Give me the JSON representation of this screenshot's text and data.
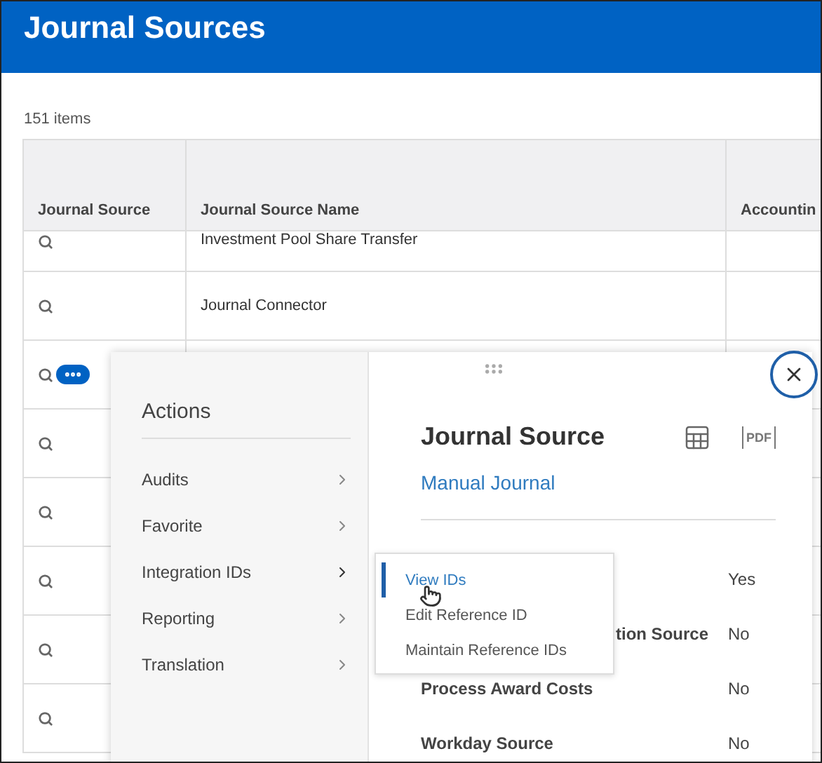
{
  "page": {
    "title": "Journal Sources",
    "count": "151 items"
  },
  "table": {
    "columns": [
      "Journal Source",
      "Journal Source Name",
      "Accountin"
    ],
    "rows": [
      {
        "name": "Investment Pool Share Transfer",
        "partial": true,
        "actions_open": false
      },
      {
        "name": "Journal Connector",
        "partial": false,
        "actions_open": false
      },
      {
        "partial": false,
        "actions_open": true
      },
      {
        "partial": false,
        "actions_open": false
      },
      {
        "partial": false,
        "actions_open": false
      },
      {
        "partial": false,
        "actions_open": false
      },
      {
        "partial": false,
        "actions_open": false
      },
      {
        "partial": false,
        "actions_open": false
      }
    ]
  },
  "actions_menu": {
    "title": "Actions",
    "items": [
      {
        "label": "Audits",
        "expanded": false
      },
      {
        "label": "Favorite",
        "expanded": false
      },
      {
        "label": "Integration IDs",
        "expanded": true
      },
      {
        "label": "Reporting",
        "expanded": false
      },
      {
        "label": "Translation",
        "expanded": false
      }
    ],
    "submenu": [
      {
        "label": "View IDs",
        "selected": true
      },
      {
        "label": "Edit Reference ID",
        "selected": false
      },
      {
        "label": "Maintain Reference IDs",
        "selected": false
      }
    ]
  },
  "detail": {
    "title": "Journal Source",
    "pdf_label": "PDF",
    "link": "Manual Journal",
    "fields": [
      {
        "value": "Yes"
      },
      {
        "label": "tion Source",
        "cut_left": true,
        "value": "No"
      },
      {
        "label": "Process Award Costs",
        "cut_left": false,
        "value": "No"
      },
      {
        "label": "Workday Source",
        "cut_left": false,
        "value": "No"
      }
    ]
  }
}
